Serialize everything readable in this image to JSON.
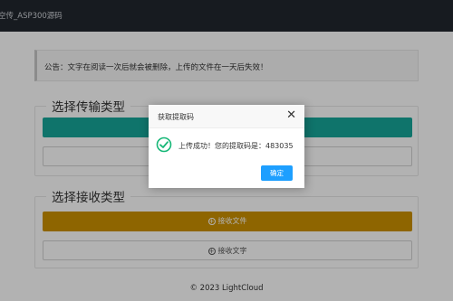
{
  "navbar": {
    "title": "空传_ASP300源码"
  },
  "notice": {
    "text": "公告：文字在阅读一次后就会被删除，上传的文件在一天后失效！"
  },
  "send_section": {
    "legend": "选择传输类型",
    "primary_button_label": "",
    "secondary_button_label": ""
  },
  "receive_section": {
    "legend": "选择接收类型",
    "file_button_label": "接收文件",
    "text_button_label": "接收文字"
  },
  "footer": {
    "text": "© 2023 LightCloud"
  },
  "modal": {
    "title": "获取提取码",
    "close_glyph": "✕",
    "message": "上传成功！您的提取码是：483035",
    "confirm_label": "确定",
    "success_icon": "check-circle-icon"
  },
  "colors": {
    "navbar": "#22272e",
    "teal": "#16a79a",
    "gold": "#cc9100",
    "confirm": "#1e9fff",
    "success": "#16b777"
  }
}
